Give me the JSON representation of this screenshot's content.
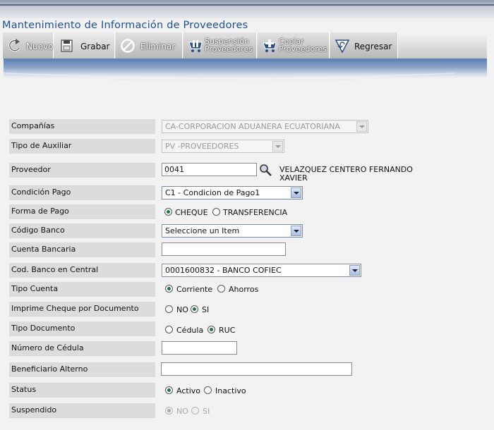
{
  "page": {
    "title": "Mantenimiento de Información de Proveedores"
  },
  "toolbar": {
    "nuevo": "Nuevo",
    "grabar": "Grabar",
    "eliminar": "Eliminar",
    "suspension_line1": "Suspensión",
    "suspension_line2": "Proveedores",
    "copiar_line1": "Copiar",
    "copiar_line2": "Proveedores",
    "regresar": "Regresar"
  },
  "form": {
    "companias": {
      "label": "Compañías",
      "value": "CA-CORPORACION ADUANERA ECUATORIANA"
    },
    "tipo_auxiliar": {
      "label": "Tipo de Auxiliar",
      "value": "PV -PROVEEDORES"
    },
    "proveedor": {
      "label": "Proveedor",
      "value": "0041",
      "name": "VELAZQUEZ CENTERO FERNANDO XAVIER"
    },
    "condicion_pago": {
      "label": "Condición Pago",
      "value": "C1 - Condicion de Pago1"
    },
    "forma_pago": {
      "label": "Forma de Pago",
      "opt1": "CHEQUE",
      "opt2": "TRANSFERENCIA",
      "selected": "CHEQUE"
    },
    "codigo_banco": {
      "label": "Código Banco",
      "value": "Seleccione un Item"
    },
    "cuenta_bancaria": {
      "label": "Cuenta Bancaria",
      "value": ""
    },
    "cod_banco_central": {
      "label": "Cod. Banco en Central",
      "value": "0001600832 - BANCO COFIEC"
    },
    "tipo_cuenta": {
      "label": "Tipo Cuenta",
      "opt1": "Corriente",
      "opt2": "Ahorros",
      "selected": "Corriente"
    },
    "imprime_cheque": {
      "label": "Imprime Cheque por Documento",
      "opt1": "NO",
      "opt2": "SI",
      "selected": "SI"
    },
    "tipo_documento": {
      "label": "Tipo Documento",
      "opt1": "Cédula",
      "opt2": "RUC",
      "selected": "RUC"
    },
    "numero_cedula": {
      "label": "Número de Cédula",
      "value": ""
    },
    "beneficiario": {
      "label": "Beneficiario Alterno",
      "value": ""
    },
    "status": {
      "label": "Status",
      "opt1": "Activo",
      "opt2": "Inactivo",
      "selected": "Activo"
    },
    "suspendido": {
      "label": "Suspendido",
      "opt1": "NO",
      "opt2": "SI",
      "selected": "NO"
    }
  },
  "colors": {
    "title": "#1e4f96",
    "label_bg": "#dcdcdc",
    "radio_on": "#1e7a3c"
  },
  "icons": [
    "refresh-icon",
    "save-icon",
    "delete-icon",
    "suspend-icon",
    "copy-icon",
    "back-icon",
    "search-icon"
  ]
}
